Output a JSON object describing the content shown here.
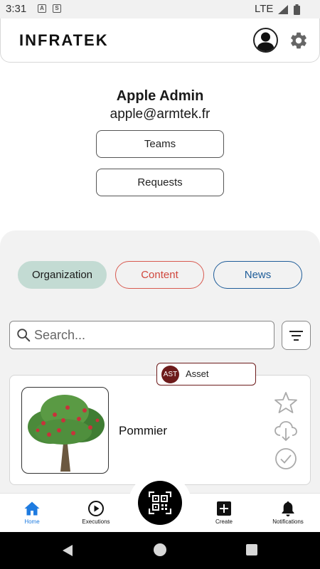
{
  "status_bar": {
    "time": "3:31",
    "network": "LTE"
  },
  "header": {
    "brand": "INFRATEK"
  },
  "profile": {
    "name": "Apple Admin",
    "email": "apple@armtek.fr",
    "teams_label": "Teams",
    "requests_label": "Requests"
  },
  "tabs": [
    {
      "label": "Organization",
      "active": true,
      "color": "#c3dbd3"
    },
    {
      "label": "Content",
      "active": false,
      "color": "#d0473d"
    },
    {
      "label": "News",
      "active": false,
      "color": "#1f5d99"
    }
  ],
  "search": {
    "placeholder": "Search...",
    "value": ""
  },
  "asset_card": {
    "tag_code": "AST",
    "tag_label": "Asset",
    "tag_color": "#6d1b1b",
    "name": "Pommier",
    "image": "apple-tree-image",
    "actions": [
      "star-icon",
      "cloud-download-icon",
      "check-circle-icon"
    ]
  },
  "bottom_nav": {
    "items": [
      {
        "label": "Home",
        "icon": "home-icon",
        "active": true
      },
      {
        "label": "Executions",
        "icon": "play-circle-icon",
        "active": false
      },
      {
        "label": "Create",
        "icon": "plus-square-icon",
        "active": false
      },
      {
        "label": "Notifications",
        "icon": "bell-icon",
        "active": false
      }
    ],
    "center_action": "qr-scan-icon",
    "accent": "#1e7be0"
  }
}
